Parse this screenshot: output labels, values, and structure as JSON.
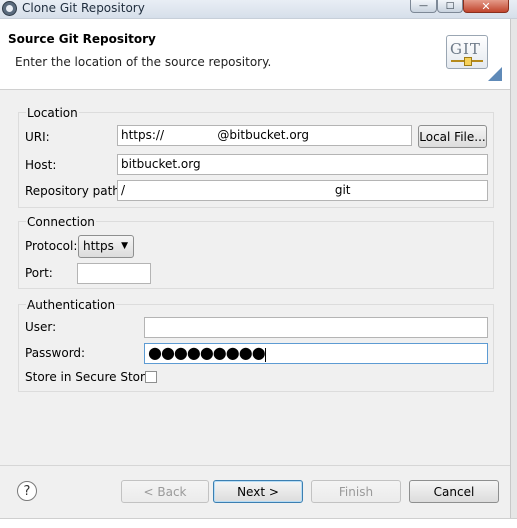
{
  "window": {
    "title": "Clone Git Repository",
    "minimize": "—",
    "maximize": "□",
    "close": "✕"
  },
  "header": {
    "title": "Source Git Repository",
    "description": "Enter the location of the source repository.",
    "logo_text": "GIT"
  },
  "location": {
    "legend": "Location",
    "uri_label": "URI:",
    "uri_value": "https://              @bitbucket.org",
    "local_file_button": "Local File...",
    "host_label": "Host:",
    "host_value": "bitbucket.org",
    "path_label": "Repository path:",
    "path_value": "/                                                       git"
  },
  "connection": {
    "legend": "Connection",
    "protocol_label": "Protocol:",
    "protocol_value": "https",
    "port_label": "Port:",
    "port_value": ""
  },
  "authentication": {
    "legend": "Authentication",
    "user_label": "User:",
    "user_value": "",
    "password_label": "Password:",
    "password_value": "●●●●●●●●●",
    "store_label": "Store in Secure Store",
    "store_checked": false
  },
  "footer": {
    "help": "?",
    "back_button": "< Back",
    "next_button": "Next >",
    "finish_button": "Finish",
    "cancel_button": "Cancel"
  },
  "colors": {
    "accent_focus": "#5d9bd3",
    "default_button_border": "#3c7fb1"
  }
}
